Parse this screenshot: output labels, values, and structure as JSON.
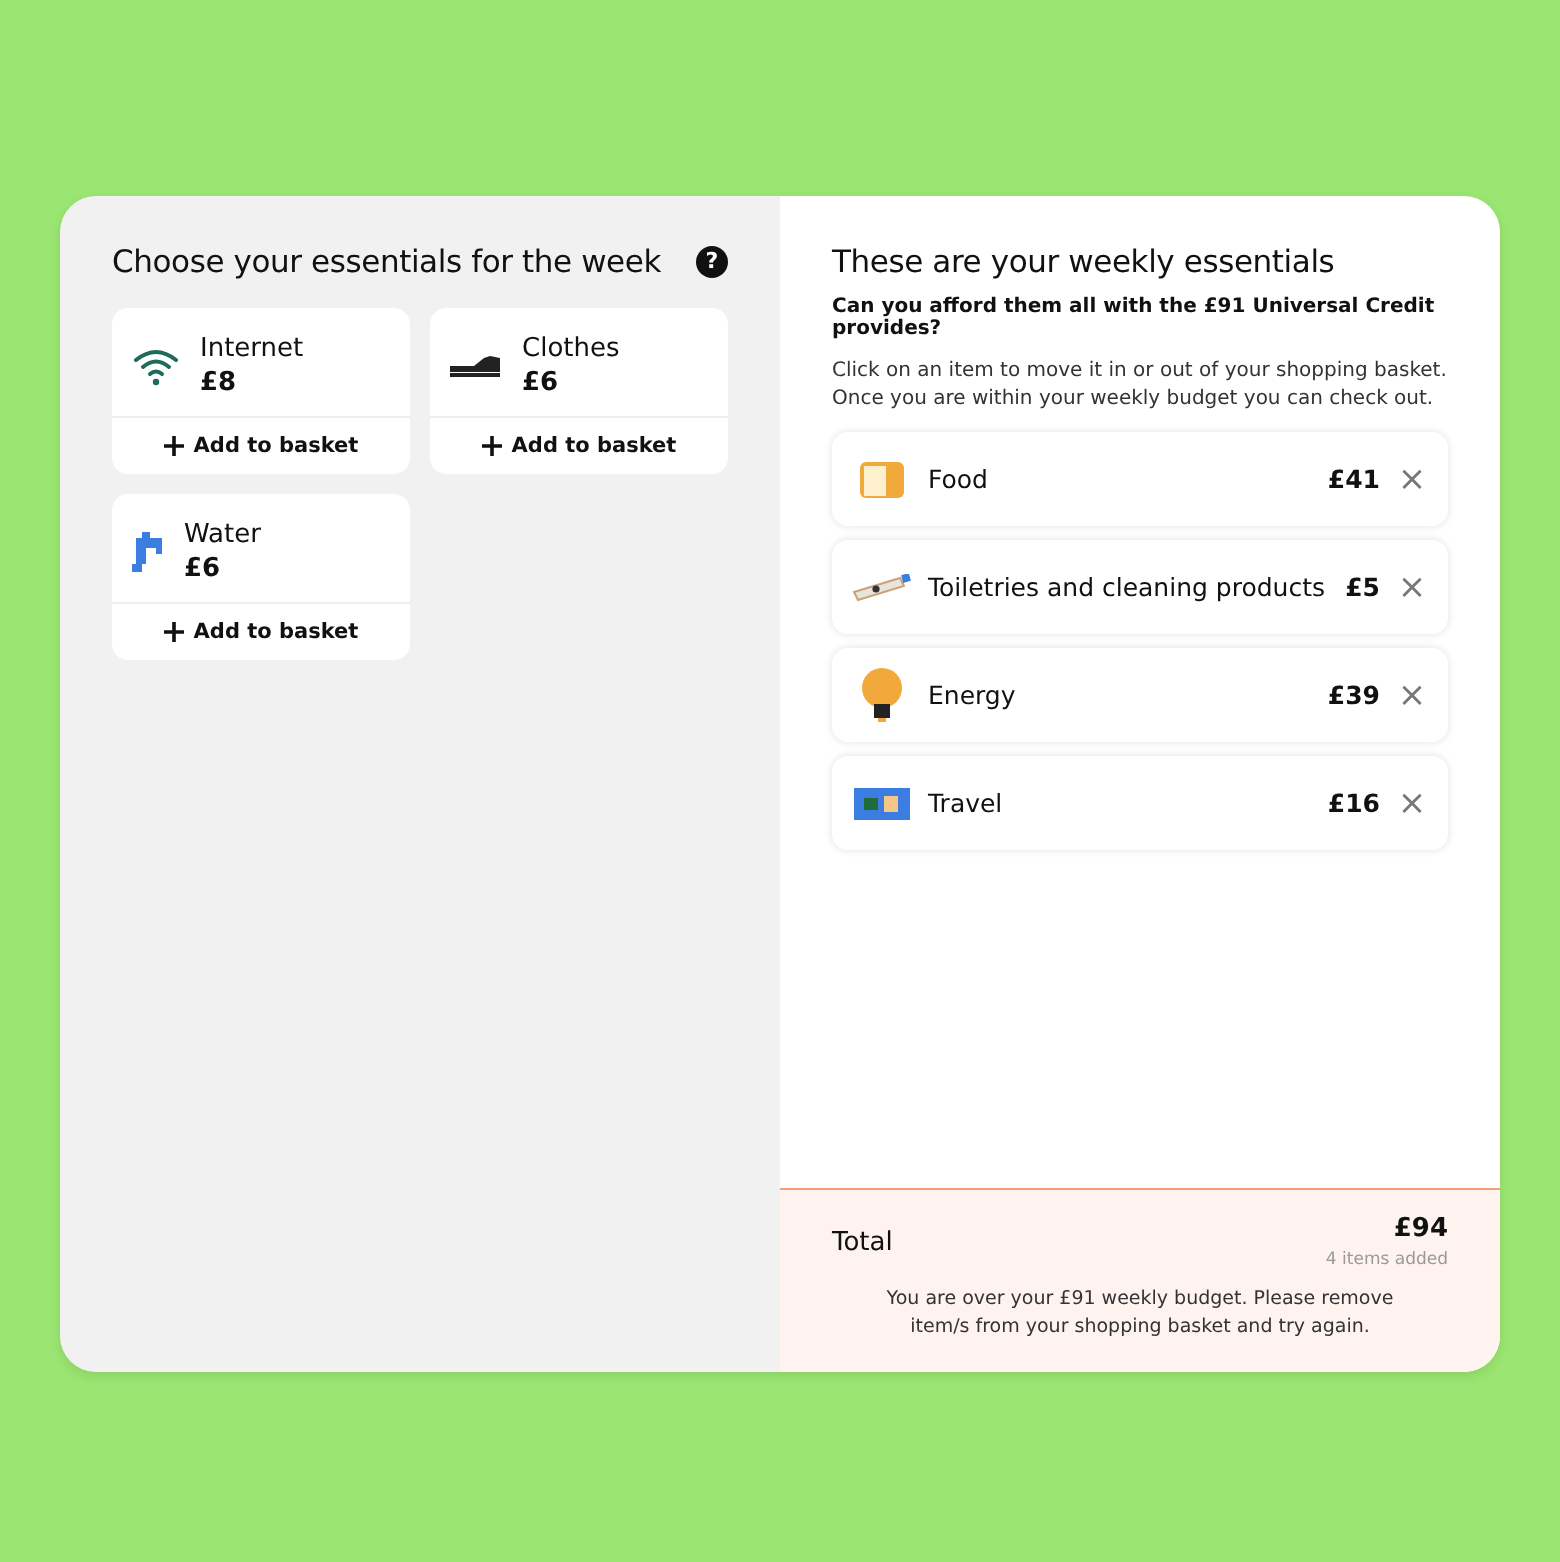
{
  "choices": {
    "title": "Choose your essentials for the week",
    "help": "?",
    "items": [
      {
        "name": "Internet",
        "price": "£8",
        "action": "Add to basket"
      },
      {
        "name": "Clothes",
        "price": "£6",
        "action": "Add to basket"
      },
      {
        "name": "Water",
        "price": "£6",
        "action": "Add to basket"
      }
    ]
  },
  "basket": {
    "title": "These are your weekly essentials",
    "question": "Can you afford them all with the £91 Universal Credit provides?",
    "instructions": "Click on an item to move it in or out of your shopping basket. Once you are within your weekly budget you can check out.",
    "items": [
      {
        "name": "Food",
        "price": "£41",
        "remove": "×"
      },
      {
        "name": "Toiletries and cleaning products",
        "price": "£5",
        "remove": "×"
      },
      {
        "name": "Energy",
        "price": "£39",
        "remove": "×"
      },
      {
        "name": "Travel",
        "price": "£16",
        "remove": "×"
      }
    ]
  },
  "total": {
    "label": "Total",
    "amount": "£94",
    "count": "4 items added",
    "message": "You are over your £91 weekly budget. Please remove item/s from your shopping basket and try again."
  }
}
